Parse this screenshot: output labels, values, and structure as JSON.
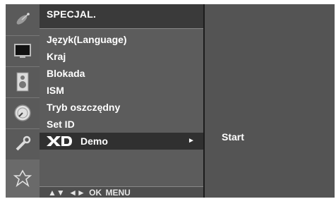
{
  "menu": {
    "title": "SPECJAL.",
    "items": [
      {
        "label": "Język(Language)"
      },
      {
        "label": "Kraj"
      },
      {
        "label": "Blokada"
      },
      {
        "label": "ISM"
      },
      {
        "label": "Tryb oszczędny"
      },
      {
        "label": "Set ID"
      }
    ],
    "demo_logo": "XD",
    "demo_label": "Demo",
    "arrow": "►",
    "footer": "▲▼ ◄► OK MENU"
  },
  "submenu": {
    "option": "Start"
  },
  "icons": [
    "satellite-dish-icon",
    "screen-icon",
    "speaker-icon",
    "clock-icon",
    "settings-key-icon",
    "special-menu-icon"
  ],
  "colors": {
    "frame": "#1c1c1c",
    "menu_bg": "#5c5c5c",
    "highlight": "#303030",
    "submenu_bg": "#545454",
    "text": "#ffffff"
  }
}
